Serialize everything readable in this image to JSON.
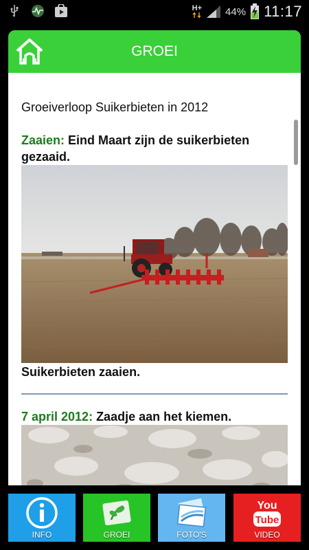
{
  "status_bar": {
    "network": "H+",
    "battery": "44%",
    "time": "11:17",
    "icons": [
      "usb-icon",
      "activity-app-icon",
      "play-store-icon",
      "network-arrows-icon",
      "signal-icon",
      "battery-charging-icon"
    ]
  },
  "header": {
    "title": "GROEI",
    "home_icon": "home-icon",
    "color": "#39d03a"
  },
  "article": {
    "heading": "Groeiverloop Suikerbieten in 2012",
    "entries": [
      {
        "lead": "Zaaien:",
        "text": " Eind Maart zijn de suikerbieten gezaaid.",
        "photo": "tractor-sowing-photo",
        "caption": "Suikerbieten zaaien."
      },
      {
        "lead": "7 april 2012:",
        "text": " Zaadje aan het kiemen.",
        "photo": "soil-closeup-photo"
      }
    ],
    "lead_color": "#1e7a1e"
  },
  "nav": {
    "info": {
      "label": "INFO",
      "color": "#1e9fe8",
      "icon": "info-icon"
    },
    "groei": {
      "label": "GROEI",
      "color": "#27c427",
      "icon": "plant-icon"
    },
    "fotos": {
      "label": "FOTO'S",
      "color": "#63b6f0",
      "icon": "photos-icon"
    },
    "video": {
      "label": "VIDEO",
      "color": "#e62020",
      "icon": "youtube-icon"
    }
  }
}
